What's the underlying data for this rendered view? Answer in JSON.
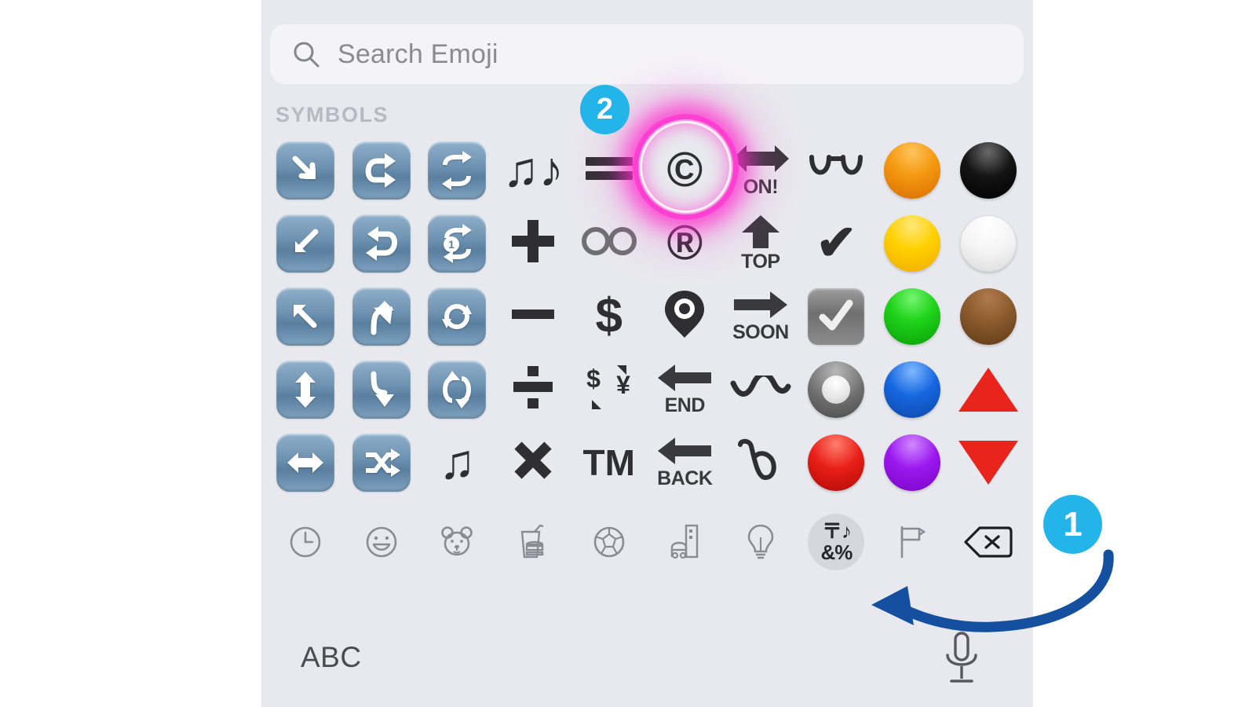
{
  "app": {
    "name": "iOS Emoji Keyboard",
    "panel_background": "#e8e9ee"
  },
  "search": {
    "placeholder": "Search Emoji",
    "value": "",
    "icon": "search-icon"
  },
  "section": {
    "title": "SYMBOLS"
  },
  "emoji_grid": {
    "columns": 10,
    "rows": 5,
    "items": [
      {
        "name": "arrow-heading-down-right",
        "kind": "bluebox",
        "glyph": "arrow-lower-right"
      },
      {
        "name": "arrow-clockwise-loop",
        "kind": "bluebox",
        "glyph": "arrow-rotate-right"
      },
      {
        "name": "repeat",
        "kind": "bluebox",
        "glyph": "repeat"
      },
      {
        "name": "musical-notes",
        "kind": "glyph",
        "char": "♫♪"
      },
      {
        "name": "heavy-equals-sign",
        "kind": "equals"
      },
      {
        "name": "copyright-sign",
        "kind": "glyph",
        "char": "©",
        "highlighted": true
      },
      {
        "name": "on-arrow",
        "kind": "labeled-arrow",
        "label": "ON!",
        "arrow": "left-right"
      },
      {
        "name": "eyeglasses-goggles",
        "kind": "goggles"
      },
      {
        "name": "orange-circle",
        "kind": "circle",
        "color": "#f59a12"
      },
      {
        "name": "black-circle",
        "kind": "circle",
        "color": "#000000"
      },
      {
        "name": "arrow-lower-left",
        "kind": "bluebox",
        "glyph": "arrow-lower-left"
      },
      {
        "name": "arrows-counterclockwise",
        "kind": "bluebox",
        "glyph": "arrow-rotate-left"
      },
      {
        "name": "repeat-one",
        "kind": "bluebox",
        "glyph": "repeat-one"
      },
      {
        "name": "heavy-plus-sign",
        "kind": "plus"
      },
      {
        "name": "infinity",
        "kind": "infinity"
      },
      {
        "name": "registered-sign",
        "kind": "glyph",
        "char": "®"
      },
      {
        "name": "top-arrow",
        "kind": "labeled-arrow",
        "label": "TOP",
        "arrow": "up"
      },
      {
        "name": "check-mark",
        "kind": "glyph",
        "char": "✔"
      },
      {
        "name": "yellow-circle",
        "kind": "circle",
        "color": "#ffd000"
      },
      {
        "name": "white-circle",
        "kind": "circle",
        "color": "#f4f4f4"
      },
      {
        "name": "arrow-upper-left",
        "kind": "bluebox",
        "glyph": "arrow-upper-left"
      },
      {
        "name": "arrow-heading-up",
        "kind": "bluebox",
        "glyph": "arrow-heading-up"
      },
      {
        "name": "arrows-counterclockwise-circle",
        "kind": "bluebox",
        "glyph": "arrows-ccw"
      },
      {
        "name": "heavy-minus-sign",
        "kind": "minus"
      },
      {
        "name": "heavy-dollar-sign",
        "kind": "glyph",
        "char": "$"
      },
      {
        "name": "round-pushpin",
        "kind": "pushpin"
      },
      {
        "name": "soon-arrow",
        "kind": "labeled-arrow",
        "label": "SOON",
        "arrow": "right"
      },
      {
        "name": "ballot-box-with-check",
        "kind": "ballot"
      },
      {
        "name": "green-circle",
        "kind": "circle",
        "color": "#1fd31a"
      },
      {
        "name": "brown-circle",
        "kind": "circle",
        "color": "#8a5a2d"
      },
      {
        "name": "up-down-arrow",
        "kind": "bluebox",
        "glyph": "arrow-up-down"
      },
      {
        "name": "arrow-heading-down",
        "kind": "bluebox",
        "glyph": "arrow-heading-down"
      },
      {
        "name": "arrows-clockwise-vertical",
        "kind": "bluebox",
        "glyph": "arrows-vertical"
      },
      {
        "name": "heavy-division-sign",
        "kind": "divide"
      },
      {
        "name": "currency-exchange",
        "kind": "currency-exchange"
      },
      {
        "name": "end-arrow",
        "kind": "labeled-arrow",
        "label": "END",
        "arrow": "left"
      },
      {
        "name": "wavy-dash",
        "kind": "wavy-dash"
      },
      {
        "name": "radio-button",
        "kind": "radio"
      },
      {
        "name": "blue-circle",
        "kind": "circle",
        "color": "#1667e0"
      },
      {
        "name": "red-triangle-pointed-up",
        "kind": "triangle-up",
        "color": "#e8241c"
      },
      {
        "name": "left-right-arrow",
        "kind": "bluebox",
        "glyph": "arrow-left-right"
      },
      {
        "name": "shuffle-tracks-button",
        "kind": "bluebox",
        "glyph": "shuffle"
      },
      {
        "name": "musical-note",
        "kind": "glyph",
        "char": "♫"
      },
      {
        "name": "multiply-sign",
        "kind": "multiply"
      },
      {
        "name": "trade-mark-sign",
        "kind": "glyph-sm",
        "char": "TM"
      },
      {
        "name": "back-arrow",
        "kind": "labeled-arrow",
        "label": "BACK",
        "arrow": "left"
      },
      {
        "name": "curly-loop",
        "kind": "curly-loop"
      },
      {
        "name": "red-circle",
        "kind": "circle",
        "color": "#e81f18"
      },
      {
        "name": "purple-circle",
        "kind": "circle",
        "color": "#9b18ef"
      },
      {
        "name": "red-triangle-pointed-down",
        "kind": "triangle-down",
        "color": "#e8241c"
      }
    ]
  },
  "category_tabs": {
    "selected": "symbols",
    "items": [
      {
        "name": "recent",
        "icon": "clock-icon"
      },
      {
        "name": "smileys",
        "icon": "smiley-icon"
      },
      {
        "name": "animals",
        "icon": "bear-icon"
      },
      {
        "name": "food",
        "icon": "food-drink-icon"
      },
      {
        "name": "activity",
        "icon": "soccer-ball-icon"
      },
      {
        "name": "travel",
        "icon": "building-car-icon"
      },
      {
        "name": "objects",
        "icon": "lightbulb-icon"
      },
      {
        "name": "symbols",
        "icon": "symbols-icon",
        "label_top": "〒♪",
        "label_bottom": "&%"
      },
      {
        "name": "flags",
        "icon": "flag-icon"
      },
      {
        "name": "delete",
        "icon": "backspace-delete-icon"
      }
    ]
  },
  "bottom_bar": {
    "abc_label": "ABC",
    "mic_icon": "microphone-icon"
  },
  "annotations": {
    "badge_color": "#23b4ea",
    "highlight_ring_color": "#ff3fd2",
    "arrow_color": "#14509f",
    "badges": [
      {
        "name": "step-1-badge",
        "label": "1",
        "points_to": "symbols-category-tab"
      },
      {
        "name": "step-2-badge",
        "label": "2",
        "points_to": "copyright-sign-emoji"
      }
    ]
  }
}
